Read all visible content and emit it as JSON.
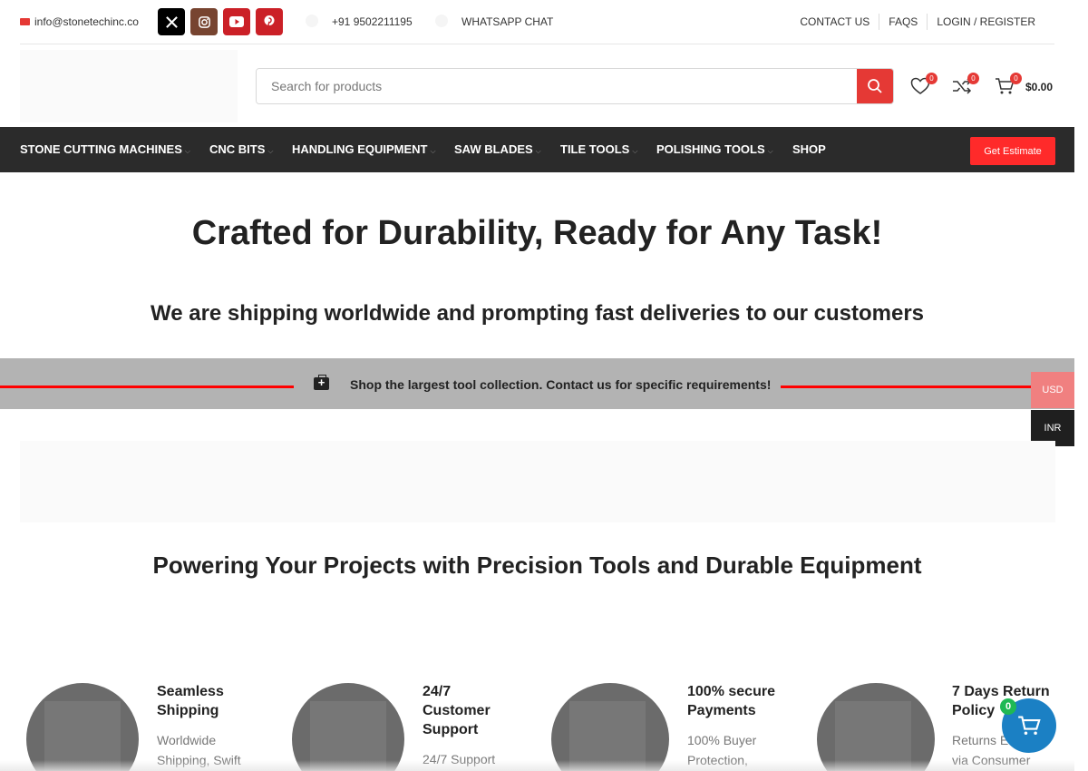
{
  "topbar": {
    "email": "info@stonetechinc.co",
    "social_icons": [
      "x-icon",
      "instagram-icon",
      "youtube-icon",
      "pinterest-icon"
    ],
    "phone": "+91 9502211195",
    "whatsapp": "WHATSAPP CHAT",
    "links": [
      "CONTACT US",
      "FAQS",
      "LOGIN / REGISTER"
    ]
  },
  "header": {
    "search_placeholder": "Search for products",
    "wishlist_count": "0",
    "compare_count": "0",
    "cart_count": "0",
    "cart_total": "$0.00"
  },
  "nav": {
    "items": [
      "STONE CUTTING MACHINES",
      "CNC BITS",
      "HANDLING EQUIPMENT",
      "SAW BLADES",
      "TILE TOOLS",
      "POLISHING TOOLS",
      "SHOP"
    ],
    "cta": "Get Estimate"
  },
  "hero": {
    "title": "Crafted for Durability, Ready for Any Task!",
    "subtitle": "We are shipping worldwide and prompting fast deliveries to our customers"
  },
  "strip": {
    "text": "Shop the largest tool collection. Contact us for specific requirements!"
  },
  "currency": [
    "USD",
    "INR"
  ],
  "section_title": "Powering Your Projects with Precision Tools and Durable Equipment",
  "features": [
    {
      "title_lines": [
        "Seamless",
        "Shipping"
      ],
      "desc_lines": [
        "Worldwide",
        "Shipping, Swift"
      ]
    },
    {
      "title_lines": [
        "24/7",
        "Customer",
        "Support"
      ],
      "desc_lines": [
        "24/7 Support"
      ]
    },
    {
      "title_lines": [
        "100% secure",
        "Payments"
      ],
      "desc_lines": [
        "100% Buyer",
        "Protection,"
      ]
    },
    {
      "title_lines": [
        "7 Days Return",
        "Policy"
      ],
      "desc_lines": [
        "Returns E",
        "via Consumer"
      ]
    }
  ],
  "floating_cart_count": "0",
  "colors": {
    "accent_red": "#e53935",
    "nav_bg": "#2b2b2b",
    "fab_blue": "#1b80c4"
  }
}
